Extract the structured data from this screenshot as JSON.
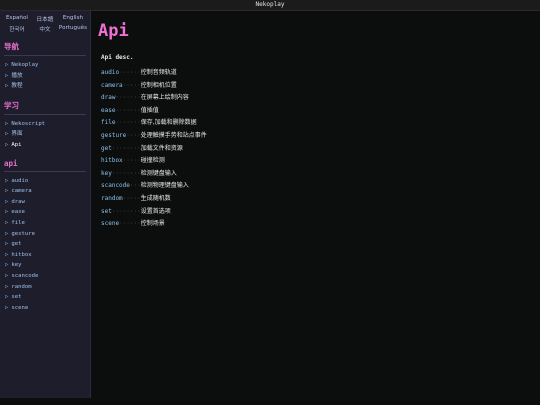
{
  "window": {
    "title": "Nekoplay"
  },
  "languages": [
    "Español",
    "日本語",
    "English",
    "한국어",
    "中文",
    "Português"
  ],
  "sections": {
    "nav": {
      "title": "导航",
      "items": [
        "Nekoplay",
        "播放",
        "教程"
      ]
    },
    "learn": {
      "title": "学习",
      "items": [
        "Nekoscript",
        "界面",
        "Api"
      ]
    },
    "api": {
      "title": "api",
      "items": [
        "audio",
        "camera",
        "draw",
        "ease",
        "file",
        "gesture",
        "get",
        "hitbox",
        "key",
        "scancode",
        "random",
        "set",
        "scene"
      ]
    }
  },
  "main": {
    "title": "Api",
    "description": "Api desc.",
    "rows": [
      {
        "name": "audio",
        "dots": "······",
        "text": "控制音频轨道"
      },
      {
        "name": "camera",
        "dots": "·····",
        "text": "控制相机位置"
      },
      {
        "name": "draw",
        "dots": "·······",
        "text": "在屏幕上绘制内容"
      },
      {
        "name": "ease",
        "dots": "·······",
        "text": "值插值"
      },
      {
        "name": "file",
        "dots": "·······",
        "text": "保存,加载和删除数据"
      },
      {
        "name": "gesture",
        "dots": "····",
        "text": "处理触摸手势和站点事件"
      },
      {
        "name": "get",
        "dots": "········",
        "text": "加载文件和资源"
      },
      {
        "name": "hitbox",
        "dots": "·····",
        "text": "碰撞检测"
      },
      {
        "name": "key",
        "dots": "········",
        "text": "检测键盘输入"
      },
      {
        "name": "scancode",
        "dots": "···",
        "text": "检测物理键盘输入"
      },
      {
        "name": "random",
        "dots": "·····",
        "text": "生成随机数"
      },
      {
        "name": "set",
        "dots": "········",
        "text": "设置首选项"
      },
      {
        "name": "scene",
        "dots": "······",
        "text": "控制场景"
      }
    ]
  },
  "colors": {
    "accent": "#f06fd4",
    "link": "#8cc0ec",
    "sidebar_bg": "#1e1d2c",
    "main_bg": "#0c0e0e"
  }
}
